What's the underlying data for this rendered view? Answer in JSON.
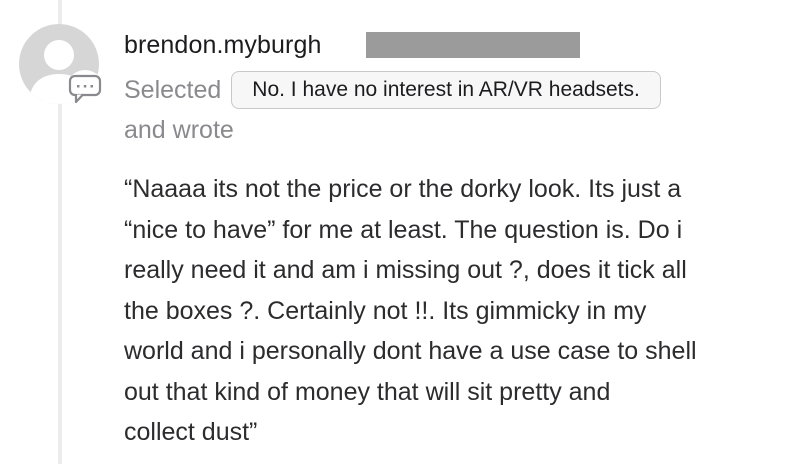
{
  "post": {
    "username": "brendon.myburgh",
    "selected_label": "Selected",
    "selected_choice": "No. I have no interest in AR/VR headsets.",
    "wrote_label": "and wrote",
    "quote_lines": [
      "“Naaaa its not the price or the dorky look. Its just a",
      "“nice to have” for me at least. The question is. Do i",
      "really need it and am i missing out ?, does it tick all",
      "the boxes ?. Certainly not !!. Its gimmicky in my",
      "world and i personally dont have a use case to shell",
      "out that kind of money that will sit pretty and",
      "collect dust”"
    ]
  },
  "icons": {
    "avatar": "default-user-avatar-icon",
    "badge": "comment-bubble-icon"
  },
  "colors": {
    "avatar_bg": "#d6d6d6",
    "avatar_fg": "#ffffff",
    "badge_stroke": "#8a8a8e",
    "redaction": "#9b9b9b",
    "muted_text": "#8a8a8e",
    "body_text": "#2c2c2e"
  }
}
